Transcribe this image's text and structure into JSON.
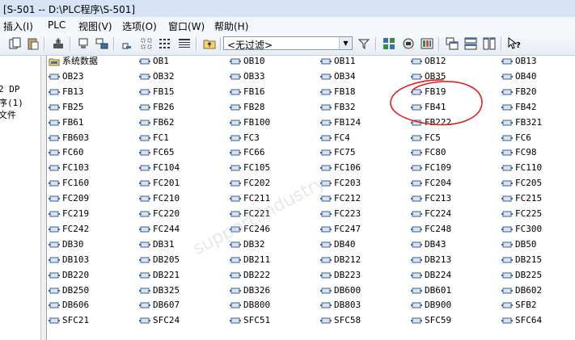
{
  "window": {
    "title": "[S-501 -- D:\\PLC程序\\S-501]"
  },
  "menu": [
    {
      "label": "插入(I)"
    },
    {
      "label": "PLC"
    },
    {
      "label": "视图(V)"
    },
    {
      "label": "选项(O)"
    },
    {
      "label": "窗口(W)"
    },
    {
      "label": "帮助(H)"
    }
  ],
  "toolbar": {
    "filter_value": "<无过滤>"
  },
  "left_tree": [
    "2 DP",
    "序(1)",
    "文件"
  ],
  "blocks": [
    [
      "系统数据",
      "OB1",
      "OB10",
      "OB11",
      "OB12",
      "OB13"
    ],
    [
      "OB23",
      "OB32",
      "OB33",
      "OB34",
      "OB35",
      "OB40"
    ],
    [
      "FB13",
      "FB15",
      "FB16",
      "FB18",
      "FB19",
      "FB20"
    ],
    [
      "FB25",
      "FB26",
      "FB28",
      "FB32",
      "FB41",
      "FB42"
    ],
    [
      "FB61",
      "FB62",
      "FB100",
      "FB124",
      "FB222",
      "FB321"
    ],
    [
      "FB603",
      "FC1",
      "FC3",
      "FC4",
      "FC5",
      "FC6"
    ],
    [
      "FC60",
      "FC65",
      "FC66",
      "FC75",
      "FC80",
      "FC98"
    ],
    [
      "FC103",
      "FC104",
      "FC105",
      "FC106",
      "FC109",
      "FC110"
    ],
    [
      "FC160",
      "FC201",
      "FC202",
      "FC203",
      "FC204",
      "FC205"
    ],
    [
      "FC209",
      "FC210",
      "FC211",
      "FC212",
      "FC213",
      "FC215"
    ],
    [
      "FC219",
      "FC220",
      "FC221",
      "FC223",
      "FC224",
      "FC225"
    ],
    [
      "FC242",
      "FC244",
      "FC246",
      "FC247",
      "FC248",
      "FC300"
    ],
    [
      "DB30",
      "DB31",
      "DB32",
      "DB40",
      "DB43",
      "DB50"
    ],
    [
      "DB103",
      "DB205",
      "DB211",
      "DB212",
      "DB213",
      "DB215"
    ],
    [
      "DB220",
      "DB221",
      "DB222",
      "DB223",
      "DB224",
      "DB225"
    ],
    [
      "DB250",
      "DB325",
      "DB326",
      "DB600",
      "DB601",
      "DB602"
    ],
    [
      "DB606",
      "DB607",
      "DB800",
      "DB803",
      "DB900",
      "SFB2"
    ],
    [
      "SFC21",
      "SFC24",
      "SFC51",
      "SFC58",
      "SFC59",
      "SFC64"
    ]
  ],
  "colors": {
    "annotation": "#e02020",
    "block_icon": "#3a5f8f"
  }
}
